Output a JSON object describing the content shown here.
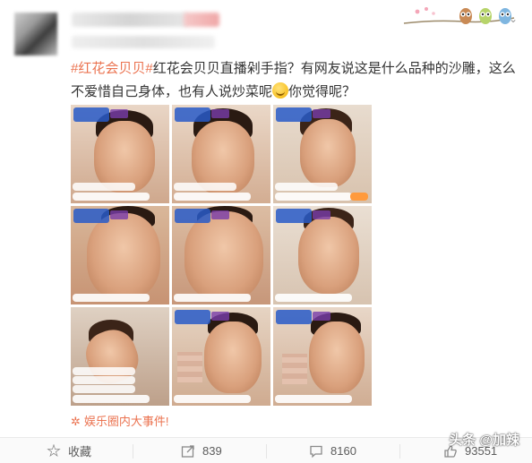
{
  "post": {
    "hashtag": "#红花会贝贝#",
    "text": "红花会贝贝直播剁手指？有网友说这是什么品种的沙雕，这么不爱惜自己身体，也有人说炒菜呢",
    "text_tail": "你觉得呢？",
    "emoji_icon": "laughing-emoji-icon"
  },
  "source": {
    "icon": "sparkle-icon",
    "label": "娱乐圈内大事件!"
  },
  "footer": {
    "favorite_label": "收藏",
    "repost_count": "839",
    "comment_count": "8160",
    "like_count": "93551"
  },
  "watermark": "头条 @加辣",
  "colors": {
    "hashtag": "#eb7350",
    "footer_bg": "#fafafa",
    "text": "#333333"
  }
}
